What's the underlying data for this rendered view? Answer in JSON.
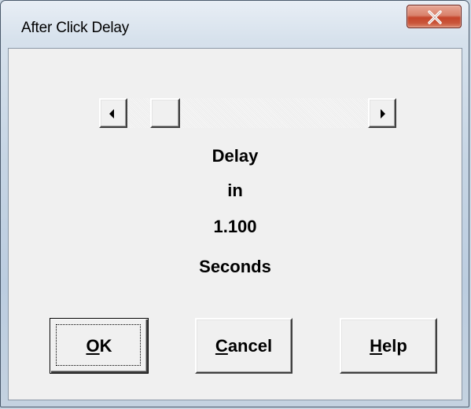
{
  "window": {
    "title": "After Click Delay",
    "close_icon": "close-x-icon"
  },
  "scrollbar": {
    "left_icon": "arrow-left-icon",
    "right_icon": "arrow-right-icon",
    "position_fraction": 0.11
  },
  "display": {
    "line1": "Delay",
    "line2": "in",
    "line3": "1.100",
    "line4": "Seconds"
  },
  "buttons": {
    "ok": {
      "mnemonic": "O",
      "rest": "K"
    },
    "cancel": {
      "mnemonic": "C",
      "rest": "ancel"
    },
    "help": {
      "mnemonic": "H",
      "rest": "elp"
    }
  }
}
